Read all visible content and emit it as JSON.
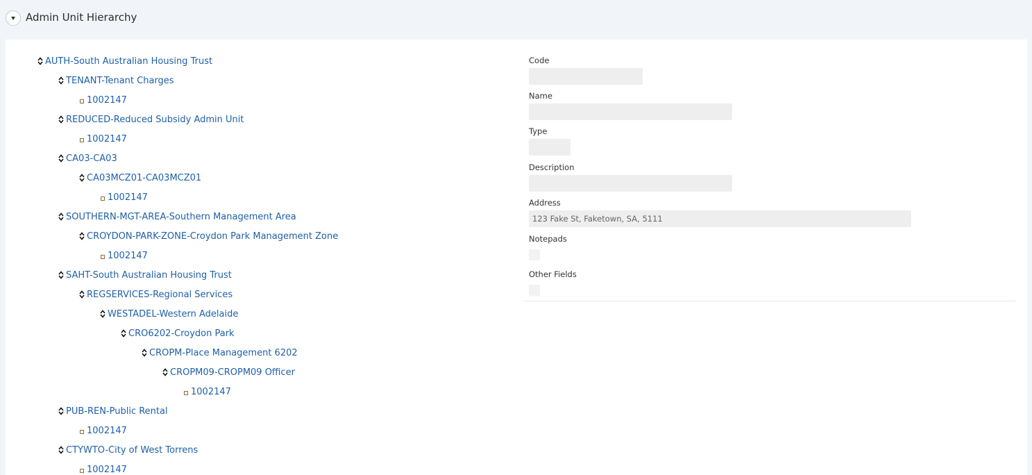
{
  "header": {
    "title": "Admin Unit Hierarchy",
    "toggle_icon": "chevron-down-icon"
  },
  "tree": [
    {
      "label": "AUTH-South Australian Housing Trust",
      "level": 0,
      "type": "branch"
    },
    {
      "label": "TENANT-Tenant Charges",
      "level": 1,
      "type": "branch"
    },
    {
      "label": "1002147",
      "level": 2,
      "type": "leaf"
    },
    {
      "label": "REDUCED-Reduced Subsidy Admin Unit",
      "level": 1,
      "type": "branch"
    },
    {
      "label": "1002147",
      "level": 2,
      "type": "leaf"
    },
    {
      "label": "CA03-CA03",
      "level": 1,
      "type": "branch"
    },
    {
      "label": "CA03MCZ01-CA03MCZ01",
      "level": 2,
      "type": "branch"
    },
    {
      "label": "1002147",
      "level": 3,
      "type": "leaf"
    },
    {
      "label": "SOUTHERN-MGT-AREA-Southern Management Area",
      "level": 1,
      "type": "branch"
    },
    {
      "label": "CROYDON-PARK-ZONE-Croydon Park Management Zone",
      "level": 2,
      "type": "branch"
    },
    {
      "label": "1002147",
      "level": 3,
      "type": "leaf"
    },
    {
      "label": "SAHT-South Australian Housing Trust",
      "level": 1,
      "type": "branch"
    },
    {
      "label": "REGSERVICES-Regional Services",
      "level": 2,
      "type": "branch"
    },
    {
      "label": "WESTADEL-Western Adelaide",
      "level": 3,
      "type": "branch"
    },
    {
      "label": "CRO6202-Croydon Park",
      "level": 4,
      "type": "branch"
    },
    {
      "label": "CROPM-Place Management 6202",
      "level": 5,
      "type": "branch"
    },
    {
      "label": "CROPM09-CROPM09 Officer",
      "level": 6,
      "type": "branch"
    },
    {
      "label": "1002147",
      "level": 7,
      "type": "leaf"
    },
    {
      "label": "PUB-REN-Public Rental",
      "level": 1,
      "type": "branch"
    },
    {
      "label": "1002147",
      "level": 2,
      "type": "leaf"
    },
    {
      "label": "CTYWTO-City of West Torrens",
      "level": 1,
      "type": "branch"
    },
    {
      "label": "1002147",
      "level": 2,
      "type": "leaf"
    }
  ],
  "details": {
    "code": {
      "label": "Code",
      "value": ""
    },
    "name": {
      "label": "Name",
      "value": ""
    },
    "type": {
      "label": "Type",
      "value": ""
    },
    "description": {
      "label": "Description",
      "value": ""
    },
    "address": {
      "label": "Address",
      "value": "123 Fake St, Faketown, SA, 5111"
    },
    "notepads": {
      "label": "Notepads"
    },
    "other_fields": {
      "label": "Other Fields"
    }
  },
  "colors": {
    "link": "#1f5fa6",
    "background": "#f1f5f9",
    "field_background": "#eeeeee"
  }
}
